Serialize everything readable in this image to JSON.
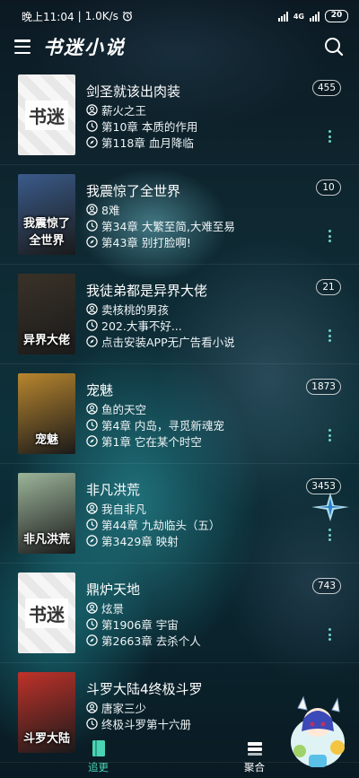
{
  "status_bar": {
    "time": "晚上11:04",
    "speed": "1.0K/s",
    "network": "4G",
    "battery": "20"
  },
  "app": {
    "title": "书迷小说"
  },
  "books": [
    {
      "title": "剑圣就该出肉装",
      "author": "薪火之王",
      "last_read": "第10章 本质的作用",
      "latest": "第118章 血月降临",
      "badge": "455",
      "cover_text": "书迷",
      "cover_type": "placeholder",
      "cover_color": "#e8e8e8"
    },
    {
      "title": "我震惊了全世界",
      "author": "8难",
      "last_read": "第34章 大繁至简,大难至易",
      "latest": "第43章 别打脸啊!",
      "badge": "10",
      "cover_text": "我震惊了全世界",
      "cover_type": "image",
      "cover_color": "#3a5b8a"
    },
    {
      "title": "我徒弟都是异界大佬",
      "author": "卖核桃的男孩",
      "last_read": "202.大事不好...",
      "latest": "点击安装APP无广告看小说",
      "badge": "21",
      "cover_text": "异界大佬",
      "cover_type": "image",
      "cover_color": "#3a3228"
    },
    {
      "title": "宠魅",
      "author": "鱼的天空",
      "last_read": "第4章 内岛，寻觅新魂宠",
      "latest": "第1章 它在某个时空",
      "badge": "1873",
      "cover_text": "宠魅",
      "cover_type": "image",
      "cover_color": "#b8862e"
    },
    {
      "title": "非凡洪荒",
      "author": "我自非凡",
      "last_read": "第44章 九劫临头（五）",
      "latest": "第3429章 映射",
      "badge": "3453",
      "cover_text": "非凡洪荒",
      "cover_type": "image",
      "cover_color": "#9cb59a"
    },
    {
      "title": "鼎炉天地",
      "author": "炫景",
      "last_read": "第1906章 宇宙",
      "latest": "第2663章 去杀个人",
      "badge": "743",
      "cover_text": "书迷",
      "cover_type": "placeholder",
      "cover_color": "#e8e8e8"
    },
    {
      "title": "斗罗大陆4终极斗罗",
      "author": "唐家三少",
      "last_read": "终极斗罗第十六册",
      "latest": "",
      "badge": "",
      "cover_text": "斗罗大陆",
      "cover_type": "image",
      "cover_color": "#c0322a"
    }
  ],
  "bottom_nav": {
    "follow": "追更",
    "aggregate": "聚合"
  },
  "colors": {
    "accent": "#4ad4b3",
    "dots": "#6fd3c8"
  },
  "icons": {
    "author": "person-circle-icon",
    "last_read": "clock-icon",
    "latest": "compass-icon"
  }
}
